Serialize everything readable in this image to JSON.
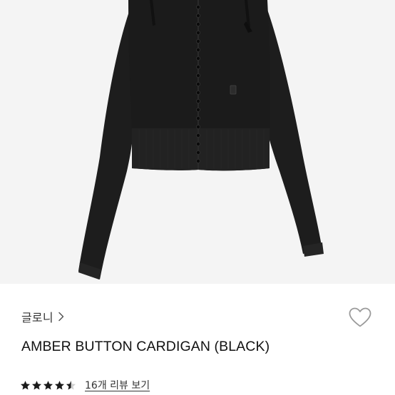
{
  "product": {
    "brand": "글로니",
    "name": "AMBER BUTTON CARDIGAN (BLACK)",
    "rating": 4.5,
    "review_link": "16개 리뷰 보기"
  },
  "icons": {
    "brand_chevron": "chevron-right-icon",
    "wishlist": "heart-outline-icon",
    "rating": "star-icon"
  },
  "colors": {
    "image_background": "#f4f4f4",
    "garment": "#1c1c1c",
    "text": "#111111",
    "heart_outline": "#9a9a9a"
  }
}
